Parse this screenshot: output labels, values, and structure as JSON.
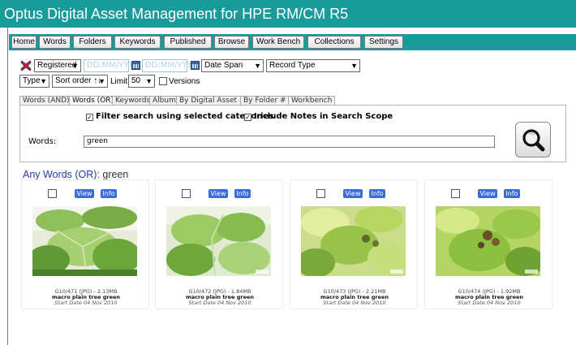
{
  "app": {
    "title": "Optus Digital Asset Management for HPE RM/CM R5"
  },
  "nav": {
    "items": [
      "Home",
      "Words",
      "Folders",
      "Keywords",
      "Published",
      "Browse",
      "Work Bench",
      "Collections",
      "Settings"
    ]
  },
  "filters": {
    "registered": "Registered",
    "date_from_placeholder": "DD/MM/YYYY",
    "date_to_placeholder": "DD/MM/YYYY",
    "date_span": "Date Span",
    "record_type": "Record Type",
    "type": "Type",
    "sort_order": "Sort order ↑↓",
    "limit_label": "Limit",
    "limit_value": "50",
    "versions_label": "Versions"
  },
  "tabs": [
    "Words (AND)",
    "Words (OR)",
    "Keywords",
    "Albums",
    "By Digital Asset #",
    "By Folder #",
    "Workbench"
  ],
  "search": {
    "filter_categories_label": "Filter search using selected categories",
    "include_notes_label": "Include Notes in Search Scope",
    "words_label": "Words:",
    "words_value": "green"
  },
  "results": {
    "heading_label": "Any Words (OR):",
    "heading_term": " green",
    "view_label": "View",
    "info_label": "Info",
    "items": [
      {
        "meta": "G10/471 (JPG) - 2.13MB",
        "title": "macro plain tree green",
        "date": "Start Date 04 Nov 2010"
      },
      {
        "meta": "G10/472 (JPG) - 1.84MB",
        "title": "macro plain tree green",
        "date": "Start Date 04 Nov 2010"
      },
      {
        "meta": "G10/473 (JPG) - 2.21MB",
        "title": "macro plain tree green",
        "date": "Start Date 04 Nov 2010"
      },
      {
        "meta": "G10/474 (JPG) - 1.92MB",
        "title": "macro plain tree green",
        "date": "Start Date 04 Nov 2010"
      }
    ]
  },
  "colors": {
    "title_bar": "#1a9b9b",
    "nav_bar": "#1a9b9b",
    "heading_blue": "#1f3d99",
    "button_blue": "#3b6dd8",
    "leaf_green": "#7fb24a"
  }
}
